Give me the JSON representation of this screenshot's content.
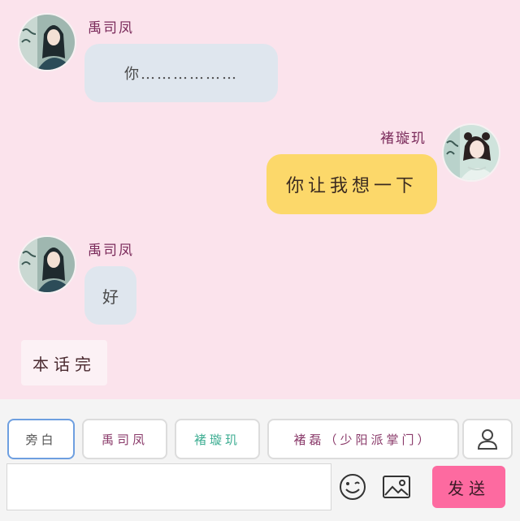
{
  "messages": [
    {
      "speaker": "禹司凤",
      "text": "你………………",
      "side": "left",
      "avatar_icon": "male-character-avatar"
    },
    {
      "speaker": "褚璇玑",
      "text": "你让我想一下",
      "side": "right",
      "avatar_icon": "female-character-avatar"
    },
    {
      "speaker": "禹司凤",
      "text": "好",
      "side": "left",
      "avatar_icon": "male-character-avatar"
    }
  ],
  "narration": "本话完",
  "roles": [
    {
      "label": "旁白",
      "color": "#555555",
      "selected": true
    },
    {
      "label": "禹司凤",
      "color": "#8a3a6a",
      "selected": false
    },
    {
      "label": "褚璇玑",
      "color": "#3fae93",
      "selected": false
    },
    {
      "label": "褚磊（少阳派掌门）",
      "color": "#8a3a6a",
      "selected": false
    }
  ],
  "toolbar": {
    "user_icon": "user-icon",
    "emoji_icon": "smiley-icon",
    "image_icon": "image-icon",
    "send_label": "发送"
  },
  "input": {
    "value": "",
    "placeholder": ""
  },
  "colors": {
    "background": "#fbe3ec",
    "bubble_left": "#dfe6ee",
    "bubble_right": "#fcd86a",
    "send_button": "#fd6aa0",
    "selected_role_border": "#6e9fe0"
  }
}
